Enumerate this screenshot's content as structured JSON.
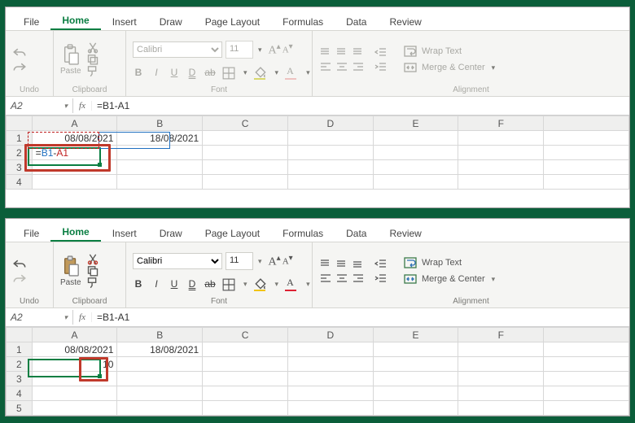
{
  "tabs": {
    "file": "File",
    "home": "Home",
    "insert": "Insert",
    "draw": "Draw",
    "page_layout": "Page Layout",
    "formulas": "Formulas",
    "data": "Data",
    "review": "Review"
  },
  "ribbon": {
    "undo_label": "Undo",
    "paste_label": "Paste",
    "clipboard_label": "Clipboard",
    "font_name": "Calibri",
    "font_size": "11",
    "font_label": "Font",
    "align_label": "Alignment",
    "wrap": "Wrap Text",
    "merge": "Merge & Center"
  },
  "win1": {
    "name_box": "A2",
    "formula": "=B1-A1",
    "a1": "08/08/2021",
    "b1": "18/08/2021",
    "a2_prefix": "=",
    "a2_b1": "B1",
    "a2_minus": "-",
    "a2_a1": "A1"
  },
  "win2": {
    "name_box": "A2",
    "formula": "=B1-A1",
    "a1": "08/08/2021",
    "b1": "18/08/2021",
    "a2": "10"
  },
  "cols": {
    "A": "A",
    "B": "B",
    "C": "C",
    "D": "D",
    "E": "E",
    "F": "F"
  },
  "rows": {
    "r1": "1",
    "r2": "2",
    "r3": "3",
    "r4": "4",
    "r5": "5"
  },
  "chart_data": null
}
